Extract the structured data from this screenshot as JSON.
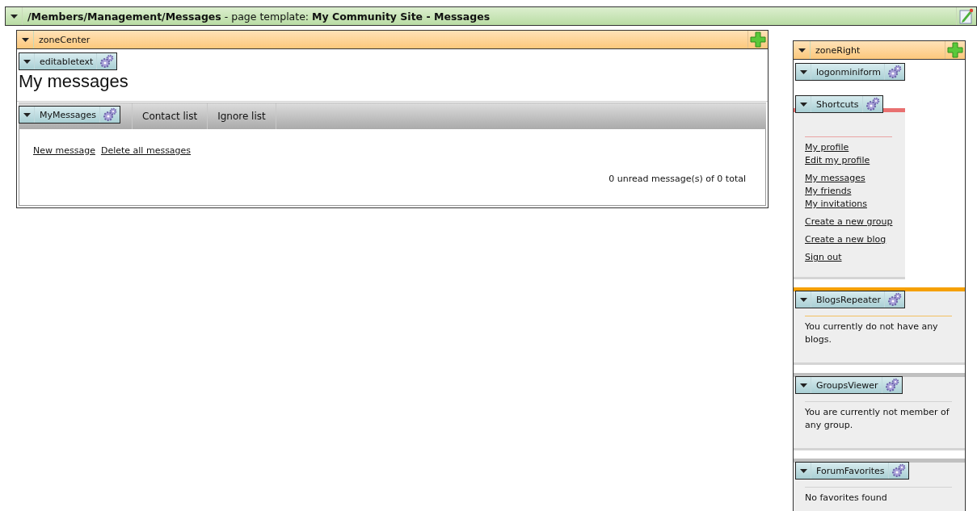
{
  "page_bar": {
    "title": "**/Members/Management/Messages** - page template: **My Community Site - Messages**"
  },
  "zone_center": {
    "title": "zoneCenter",
    "editable_text": {
      "webpart": "editabletext",
      "heading": "My messages"
    },
    "messages": {
      "webpart": "MyMessages",
      "tabs": [
        {
          "label": "Contact list",
          "selected": false
        },
        {
          "label": "Ignore list",
          "selected": false
        }
      ],
      "links": [
        "New message",
        "Delete all messages"
      ],
      "summary": "0 unread message(s) of 0 total"
    }
  },
  "zone_right": {
    "title": "zoneRight",
    "webparts": [
      {
        "webpart": "logonminiform",
        "kind": "empty"
      },
      {
        "webpart": "Shortcuts",
        "kind": "links",
        "color": "#e87070",
        "groups": [
          {
            "links": [
              "My profile",
              "Edit my profile"
            ]
          },
          {
            "links": [
              "My messages",
              "My friends",
              "My invitations"
            ]
          },
          {
            "links": [
              "Create a new group"
            ]
          },
          {
            "links": [
              "Create a new blog"
            ]
          },
          {
            "links": [
              "Sign out"
            ]
          }
        ]
      },
      {
        "webpart": "BlogsRepeater",
        "kind": "text",
        "color": "#f5a000",
        "text": "You currently do not have any blogs."
      },
      {
        "webpart": "GroupsViewer",
        "kind": "text",
        "color": "#c0c0c0",
        "text": "You are currently not member of any group."
      },
      {
        "webpart": "ForumFavorites",
        "kind": "text",
        "color": "#c0c0c0",
        "text": "No favorites found"
      }
    ]
  }
}
